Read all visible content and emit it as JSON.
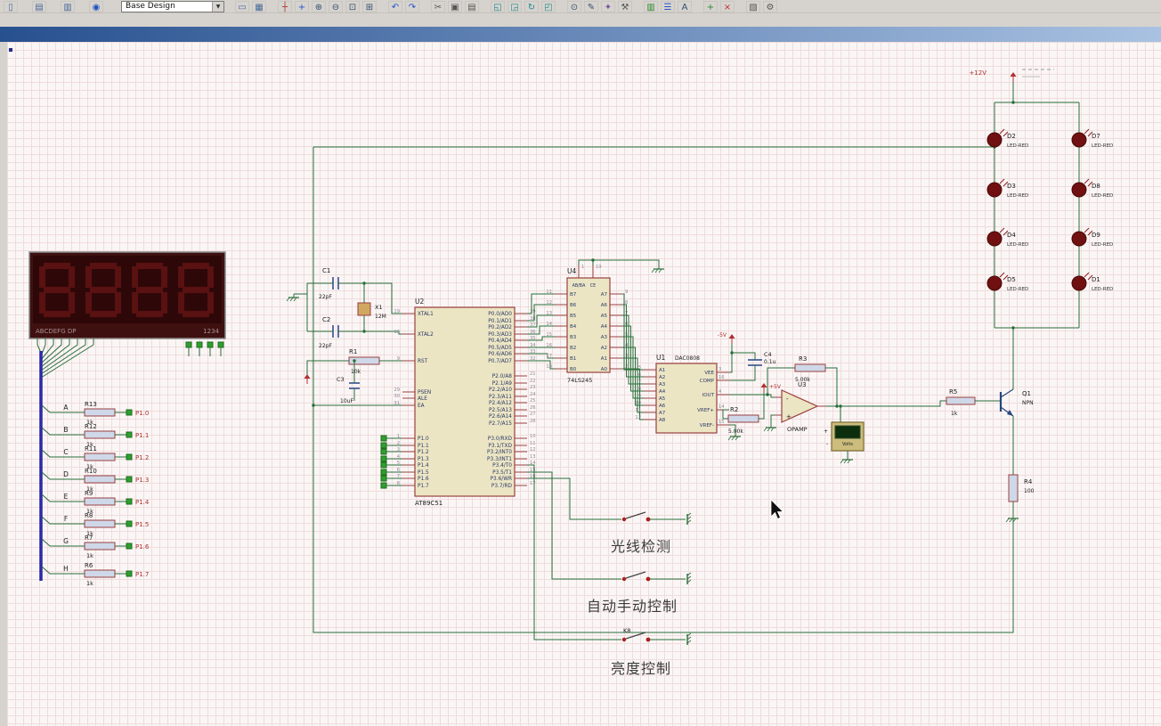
{
  "toolbar": {
    "design_selector": "Base Design",
    "file_icons": [
      {
        "name": "new-file-icon",
        "glyph": "▯",
        "color": "#4a6a9a"
      },
      {
        "name": "notes-icon",
        "glyph": "▤",
        "color": "#4a6a9a"
      },
      {
        "name": "export-icon",
        "glyph": "▥",
        "color": "#4a6a9a"
      },
      {
        "name": "help-icon",
        "glyph": "◉",
        "color": "#1a52c0"
      }
    ],
    "tool_icons": [
      {
        "name": "sheet-border-icon",
        "glyph": "▭",
        "color": "#4a6a9a"
      },
      {
        "name": "grid-toggle-icon",
        "glyph": "▦",
        "color": "#4a6a9a"
      },
      {
        "sep": true
      },
      {
        "name": "origin-icon",
        "glyph": "┼",
        "color": "#b03030"
      },
      {
        "name": "pan-icon",
        "glyph": "+",
        "color": "#2255cc"
      },
      {
        "name": "zoom-in-icon",
        "glyph": "⊕",
        "color": "#33506e"
      },
      {
        "name": "zoom-out-icon",
        "glyph": "⊖",
        "color": "#33506e"
      },
      {
        "name": "zoom-area-icon",
        "glyph": "⊡",
        "color": "#33506e"
      },
      {
        "name": "zoom-extents-icon",
        "glyph": "⊞",
        "color": "#33506e"
      },
      {
        "sep": true
      },
      {
        "name": "undo-icon",
        "glyph": "↶",
        "color": "#2255cc"
      },
      {
        "name": "redo-icon",
        "glyph": "↷",
        "color": "#2255cc"
      },
      {
        "sep": true
      },
      {
        "name": "cut-icon",
        "glyph": "✂",
        "color": "#555555"
      },
      {
        "name": "copy-icon",
        "glyph": "▣",
        "color": "#555555"
      },
      {
        "name": "paste-icon",
        "glyph": "▤",
        "color": "#555555"
      },
      {
        "sep": true
      },
      {
        "name": "block-copy-icon",
        "glyph": "◱",
        "color": "#1f8a8a"
      },
      {
        "name": "block-move-icon",
        "glyph": "◲",
        "color": "#1f8a8a"
      },
      {
        "name": "block-rotate-icon",
        "glyph": "↻",
        "color": "#1f8a8a"
      },
      {
        "name": "block-delete-icon",
        "glyph": "◰",
        "color": "#1f8a8a"
      },
      {
        "sep": true
      },
      {
        "name": "pick-parts-icon",
        "glyph": "⊙",
        "color": "#33506e"
      },
      {
        "name": "edit-icon",
        "glyph": "✎",
        "color": "#33506e"
      },
      {
        "name": "property-tool-icon",
        "glyph": "✦",
        "color": "#7a55a0"
      },
      {
        "name": "design-tool-icon",
        "glyph": "⚒",
        "color": "#555555"
      },
      {
        "sep": true
      },
      {
        "name": "graph-icon",
        "glyph": "▥",
        "color": "#2d8a2d"
      },
      {
        "name": "bom-icon",
        "glyph": "☰",
        "color": "#2255cc"
      },
      {
        "name": "netlist-icon",
        "glyph": "A",
        "color": "#33506e"
      },
      {
        "sep": true
      },
      {
        "name": "add-sheet-icon",
        "glyph": "+",
        "color": "#2d8a2d"
      },
      {
        "name": "remove-sheet-icon",
        "glyph": "×",
        "color": "#c03030"
      },
      {
        "sep": true
      },
      {
        "name": "clipboard-icon",
        "glyph": "▧",
        "color": "#555555"
      },
      {
        "name": "gear-icon",
        "glyph": "⚙",
        "color": "#555555"
      }
    ]
  },
  "canvas": {
    "display": {
      "strip_left": "ABCDEFG DP",
      "strip_right": "1234"
    },
    "ladder": {
      "rows": [
        {
          "net": "A",
          "ref": "R13",
          "value": "1k",
          "terminal": "P1.0"
        },
        {
          "net": "B",
          "ref": "R12",
          "value": "1k",
          "terminal": "P1.1"
        },
        {
          "net": "C",
          "ref": "R11",
          "value": "1k",
          "terminal": "P1.2"
        },
        {
          "net": "D",
          "ref": "R10",
          "value": "1k",
          "terminal": "P1.3"
        },
        {
          "net": "E",
          "ref": "R9",
          "value": "1k",
          "terminal": "P1.4"
        },
        {
          "net": "F",
          "ref": "R8",
          "value": "1k",
          "terminal": "P1.5"
        },
        {
          "net": "G",
          "ref": "R7",
          "value": "1k",
          "terminal": "P1.6"
        },
        {
          "net": "H",
          "ref": "R6",
          "value": "1k",
          "terminal": "P1.7"
        }
      ]
    },
    "xtal": {
      "c1": {
        "ref": "C1",
        "value": "22pF"
      },
      "c2": {
        "ref": "C2",
        "value": "22pF"
      },
      "x1": {
        "ref": "X1",
        "value": "12M"
      },
      "r1": {
        "ref": "R1",
        "value": "10k"
      },
      "c3": {
        "ref": "C3",
        "value": "10uF"
      }
    },
    "mcu": {
      "ref": "U2",
      "part": "AT89C51",
      "left_pins": [
        {
          "num": "19",
          "name": "XTAL1"
        },
        {
          "num": "18",
          "name": "XTAL2"
        },
        {
          "num": "9",
          "name": "RST"
        },
        {
          "num": "29",
          "name": "PSEN"
        },
        {
          "num": "30",
          "name": "ALE"
        },
        {
          "num": "31",
          "name": "EA"
        },
        {
          "num": "1",
          "name": "P1.0"
        },
        {
          "num": "2",
          "name": "P1.1"
        },
        {
          "num": "3",
          "name": "P1.2"
        },
        {
          "num": "4",
          "name": "P1.3"
        },
        {
          "num": "5",
          "name": "P1.4"
        },
        {
          "num": "6",
          "name": "P1.5"
        },
        {
          "num": "7",
          "name": "P1.6"
        },
        {
          "num": "8",
          "name": "P1.7"
        }
      ],
      "right_pins": [
        {
          "num": "39",
          "name": "P0.0/AD0"
        },
        {
          "num": "38",
          "name": "P0.1/AD1"
        },
        {
          "num": "37",
          "name": "P0.2/AD2"
        },
        {
          "num": "36",
          "name": "P0.3/AD3"
        },
        {
          "num": "35",
          "name": "P0.4/AD4"
        },
        {
          "num": "34",
          "name": "P0.5/AD5"
        },
        {
          "num": "33",
          "name": "P0.6/AD6"
        },
        {
          "num": "32",
          "name": "P0.7/AD7"
        },
        {
          "num": "21",
          "name": "P2.0/A8"
        },
        {
          "num": "22",
          "name": "P2.1/A9"
        },
        {
          "num": "23",
          "name": "P2.2/A10"
        },
        {
          "num": "24",
          "name": "P2.3/A11"
        },
        {
          "num": "25",
          "name": "P2.4/A12"
        },
        {
          "num": "26",
          "name": "P2.5/A13"
        },
        {
          "num": "27",
          "name": "P2.6/A14"
        },
        {
          "num": "28",
          "name": "P2.7/A15"
        },
        {
          "num": "10",
          "name": "P3.0/RXD"
        },
        {
          "num": "11",
          "name": "P3.1/TXD"
        },
        {
          "num": "12",
          "name": "P3.2/INT0"
        },
        {
          "num": "13",
          "name": "P3.3/INT1"
        },
        {
          "num": "14",
          "name": "P3.4/T0"
        },
        {
          "num": "15",
          "name": "P3.5/T1"
        },
        {
          "num": "16",
          "name": "P3.6/WR"
        },
        {
          "num": "17",
          "name": "P3.7/RD"
        }
      ]
    },
    "buffer": {
      "ref": "U4",
      "part": "74LS245",
      "left_pins": [
        {
          "num": "11",
          "name": "B7"
        },
        {
          "num": "12",
          "name": "B6"
        },
        {
          "num": "13",
          "name": "B5"
        },
        {
          "num": "14",
          "name": "B4"
        },
        {
          "num": "15",
          "name": "B3"
        },
        {
          "num": "16",
          "name": "B2"
        },
        {
          "num": "17",
          "name": "B1"
        },
        {
          "num": "18",
          "name": "B0"
        }
      ],
      "right_pins": [
        {
          "num": "9",
          "name": "A7"
        },
        {
          "num": "8",
          "name": "A6"
        },
        {
          "num": "7",
          "name": "A5"
        },
        {
          "num": "6",
          "name": "A4"
        },
        {
          "num": "5",
          "name": "A3"
        },
        {
          "num": "4",
          "name": "A2"
        },
        {
          "num": "3",
          "name": "A1"
        },
        {
          "num": "2",
          "name": "A0"
        }
      ],
      "top_pins": [
        {
          "num": "1",
          "name": "AB/BA"
        },
        {
          "num": "19",
          "name": "CE"
        }
      ]
    },
    "dac": {
      "ref": "U1",
      "part": "DAC0808",
      "left_pins": [
        {
          "num": "5",
          "name": "A1"
        },
        {
          "num": "6",
          "name": "A2"
        },
        {
          "num": "7",
          "name": "A3"
        },
        {
          "num": "8",
          "name": "A4"
        },
        {
          "num": "9",
          "name": "A5"
        },
        {
          "num": "10",
          "name": "A6"
        },
        {
          "num": "11",
          "name": "A7"
        },
        {
          "num": "12",
          "name": "A8"
        }
      ],
      "right_pins": [
        {
          "num": "3",
          "name": "VEE"
        },
        {
          "num": "16",
          "name": "COMP"
        },
        {
          "num": "4",
          "name": "IOUT"
        },
        {
          "num": "14",
          "name": "VREF+"
        },
        {
          "num": "15",
          "name": "VREF-"
        }
      ]
    },
    "analog": {
      "c4": {
        "ref": "C4",
        "value": "0.1u"
      },
      "r3": {
        "ref": "R3",
        "value": "5.00k"
      },
      "r2": {
        "ref": "R2",
        "value": "5.00k"
      },
      "opamp": {
        "ref": "U3",
        "part": "OPAMP",
        "in_minus": "-",
        "in_plus": "+"
      },
      "meter_label": "Volts",
      "meter_plus": "+",
      "meter_minus": "-",
      "r5": {
        "ref": "R5",
        "value": "1k"
      },
      "q1": {
        "ref": "Q1",
        "part": "NPN"
      },
      "r4": {
        "ref": "R4",
        "value": "100"
      }
    },
    "power": {
      "v12": "+12V",
      "vneg5": "-5V",
      "vpos5": "+5V"
    },
    "leds": {
      "left": [
        {
          "ref": "D2",
          "part": "LED-RED"
        },
        {
          "ref": "D3",
          "part": "LED-RED"
        },
        {
          "ref": "D4",
          "part": "LED-RED"
        },
        {
          "ref": "D5",
          "part": "LED-RED"
        }
      ],
      "right": [
        {
          "ref": "D7",
          "part": "LED-RED"
        },
        {
          "ref": "D8",
          "part": "LED-RED"
        },
        {
          "ref": "D9",
          "part": "LED-RED"
        },
        {
          "ref": "D1",
          "part": "LED-RED"
        }
      ]
    },
    "switches": [
      {
        "label": "光线检测"
      },
      {
        "label": "自动手动控制"
      },
      {
        "key": "K8",
        "label": "亮度控制"
      }
    ]
  },
  "colors": {
    "wire": "#276e39",
    "bus": "#2a2aa8",
    "outline": "#9a4040",
    "body": "#ece5c4",
    "pin_name": "#2a3a66",
    "pin_num": "#8a8a95",
    "label": "#1a1a1a",
    "terminal": "#b03030",
    "power": "#b03030",
    "res_fill": "#cfd8e8",
    "cap": "#31508c",
    "led": "#701010",
    "green": "#2f9e2f",
    "green_dark": "#1e6e1e"
  }
}
